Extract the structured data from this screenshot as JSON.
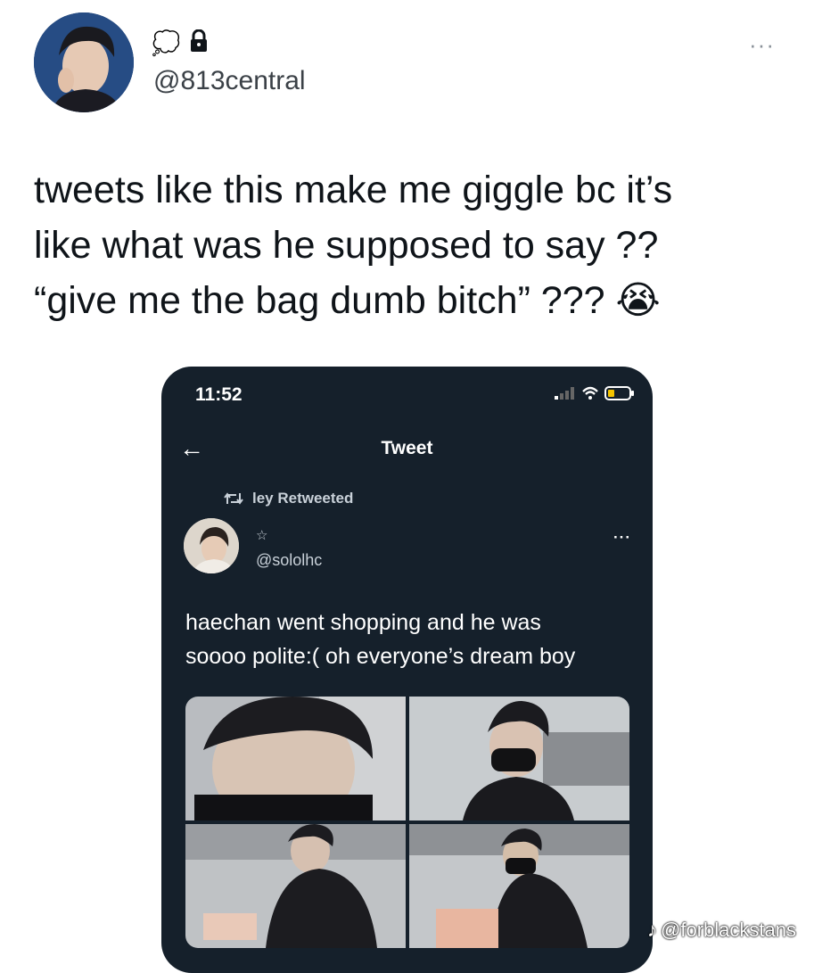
{
  "author": {
    "handle": "@813central",
    "name_emoji": "💭",
    "lock_icon": "lock-icon"
  },
  "more_label": "···",
  "tweet": {
    "lines": [
      "tweets like this make me giggle bc it’s",
      "like what was he supposed to say ??",
      "“give me the bag dumb bitch” ???"
    ],
    "emoji": "😭"
  },
  "embedded": {
    "time": "11:52",
    "title": "Tweet",
    "retweet_label": "ley Retweeted",
    "star": "☆",
    "handle": "@sololhc",
    "more_label": "···",
    "text_lines": [
      "haechan went shopping and he was",
      "soooo polite:( oh everyone’s dream boy"
    ],
    "back_glyph": "←"
  },
  "watermark": {
    "logo": "♪",
    "text": "@forblackstans"
  },
  "colors": {
    "phone_bg": "#15202b",
    "text": "#0f1419"
  }
}
